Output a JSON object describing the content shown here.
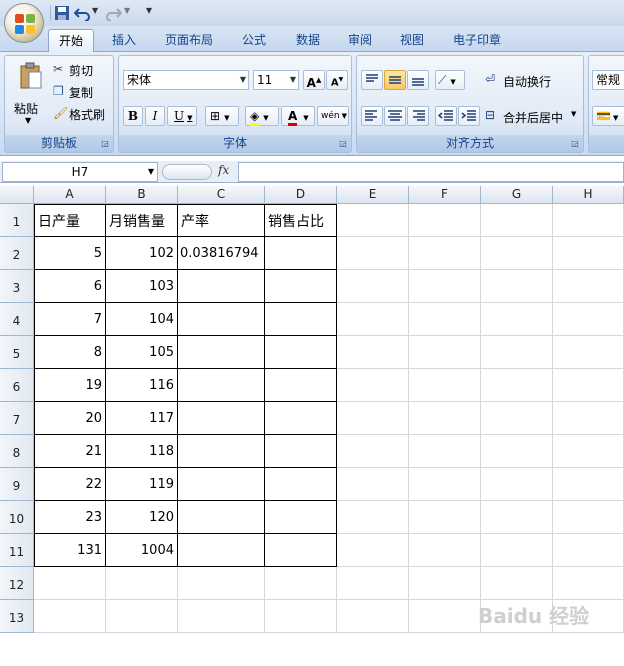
{
  "ribbon_tabs": [
    "开始",
    "插入",
    "页面布局",
    "公式",
    "数据",
    "审阅",
    "视图",
    "电子印章"
  ],
  "clipboard": {
    "paste_label": "粘贴",
    "cut_label": "剪切",
    "copy_label": "复制",
    "format_painter_label": "格式刷",
    "group_label": "剪贴板"
  },
  "font": {
    "font_name": "宋体",
    "font_size": "11",
    "group_label": "字体",
    "bold": "B",
    "italic": "I",
    "underline": "U",
    "grow": "A",
    "shrink": "A",
    "font_color_glyph": "A",
    "phonetic_glyph": "wén"
  },
  "alignment": {
    "wrap_text_label": "自动换行",
    "merge_center_label": "合并后居中",
    "group_label": "对齐方式"
  },
  "number": {
    "format_value": "常规"
  },
  "formula_bar": {
    "name_box": "H7",
    "fx": "fx",
    "formula": ""
  },
  "columns": [
    "A",
    "B",
    "C",
    "D",
    "E",
    "F",
    "G",
    "H"
  ],
  "rows": [
    "1",
    "2",
    "3",
    "4",
    "5",
    "6",
    "7",
    "8",
    "9",
    "10",
    "11",
    "12",
    "13"
  ],
  "header_row": {
    "a": "日产量",
    "b": "月销售量",
    "c": "产率",
    "d": "销售占比"
  },
  "data_rows": [
    {
      "a": "5",
      "b": "102",
      "c": "0.03816794",
      "d": ""
    },
    {
      "a": "6",
      "b": "103",
      "c": "",
      "d": ""
    },
    {
      "a": "7",
      "b": "104",
      "c": "",
      "d": ""
    },
    {
      "a": "8",
      "b": "105",
      "c": "",
      "d": ""
    },
    {
      "a": "19",
      "b": "116",
      "c": "",
      "d": ""
    },
    {
      "a": "20",
      "b": "117",
      "c": "",
      "d": ""
    },
    {
      "a": "21",
      "b": "118",
      "c": "",
      "d": ""
    },
    {
      "a": "22",
      "b": "119",
      "c": "",
      "d": ""
    },
    {
      "a": "23",
      "b": "120",
      "c": "",
      "d": ""
    },
    {
      "a": "131",
      "b": "1004",
      "c": "",
      "d": ""
    }
  ],
  "watermark": "Baidu 经验",
  "colors": {
    "ribbon_bg": "#dae6f5",
    "tab_text": "#15428b",
    "grid_line": "#d4d8de",
    "table_border": "#000000"
  }
}
